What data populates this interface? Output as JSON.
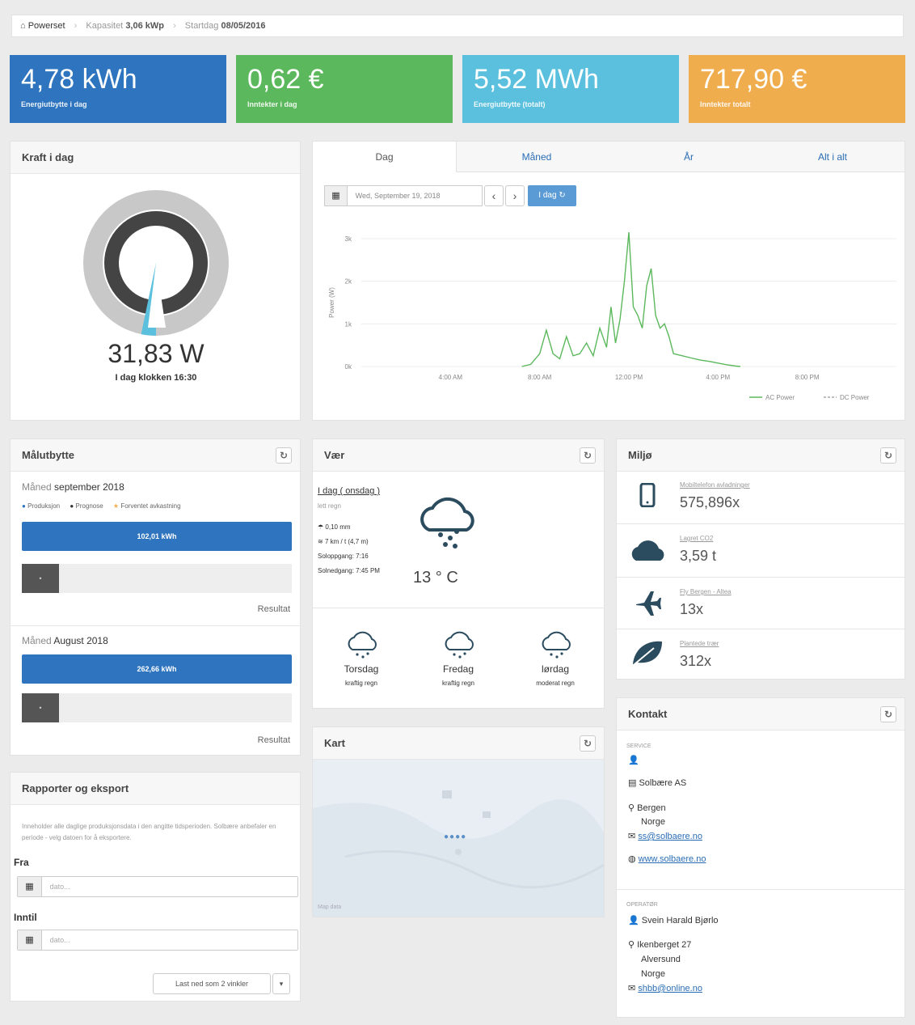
{
  "breadcrumb": {
    "home": "Powerset",
    "capacity_label": "Kapasitet",
    "capacity_value": "3,06 kWp",
    "start_label": "Startdag",
    "start_value": "08/05/2016"
  },
  "tiles": [
    {
      "value": "4,78 kWh",
      "label": "Energiutbytte i dag",
      "color": "#2e74be"
    },
    {
      "value": "0,62 €",
      "label": "Inntekter i dag",
      "color": "#5cb85c"
    },
    {
      "value": "5,52 MWh",
      "label": "Energiutbytte (totalt)",
      "color": "#5bc0de"
    },
    {
      "value": "717,90 €",
      "label": "Inntekter totalt",
      "color": "#f0ad4e"
    }
  ],
  "power_today": {
    "title": "Kraft i dag",
    "value": "31,83 W",
    "subtitle": "I dag klokken 16:30",
    "gauge_fraction": 0.02
  },
  "chart_panel": {
    "tabs": [
      "Dag",
      "Måned",
      "År",
      "Alt i alt"
    ],
    "active_tab": 0,
    "date_value": "Wed, September 19, 2018",
    "today_button": "I dag",
    "prev": "‹",
    "next": "›"
  },
  "chart_data": {
    "type": "line",
    "ylabel": "Power (W)",
    "y_ticks": [
      "0k",
      "1k",
      "2k",
      "3k"
    ],
    "x_ticks": [
      "4:00 AM",
      "8:00 AM",
      "12:00 PM",
      "4:00 PM",
      "8:00 PM"
    ],
    "ylim": [
      0,
      3000
    ],
    "xlim": [
      0,
      24
    ],
    "legend_position": "bottom-right",
    "series": [
      {
        "name": "AC Power",
        "color": "#5cb85c",
        "x": [
          7.2,
          7.6,
          8.0,
          8.3,
          8.6,
          8.9,
          9.2,
          9.5,
          9.8,
          10.1,
          10.4,
          10.7,
          11.0,
          11.2,
          11.4,
          11.6,
          11.8,
          12.0,
          12.2,
          12.4,
          12.6,
          12.8,
          13.0,
          13.2,
          13.4,
          13.6,
          13.8,
          14.0,
          14.4,
          14.8,
          15.2,
          15.6,
          16.0,
          16.4,
          16.8,
          17.0
        ],
        "y": [
          0,
          50,
          300,
          850,
          300,
          180,
          700,
          250,
          300,
          550,
          250,
          900,
          450,
          1400,
          550,
          1100,
          2000,
          3300,
          1400,
          1200,
          900,
          1900,
          2300,
          1200,
          900,
          1000,
          700,
          300,
          250,
          200,
          150,
          120,
          80,
          40,
          10,
          0
        ]
      },
      {
        "name": "DC Power",
        "color": "#aaaaaa",
        "x": [],
        "y": []
      }
    ]
  },
  "maalutbytte": {
    "title": "Målutbytte",
    "month1_label": "Måned",
    "month1_value": "september 2018",
    "legend": [
      "Produksjon",
      "Prognose",
      "Forventet avkastning"
    ],
    "legend_colors": [
      "#2e74be",
      "#333333",
      "#f0ad4e"
    ],
    "bar1_label": "102,01 kWh",
    "result1": "Resultat",
    "month2_label": "Måned",
    "month2_value": "August 2018",
    "bar2_label": "262,66 kWh",
    "result2": "Resultat"
  },
  "weather": {
    "title": "Vær",
    "day_header": "I dag ( onsdag )",
    "condition": "lett regn",
    "precip": "0,10 mm",
    "wind": "7 km / t (4,7 m)",
    "sunrise": "Soloppgang: 7:16",
    "sunset": "Solnedgang: 7:45 PM",
    "temp": "13 ° C",
    "forecast": [
      {
        "day": "Torsdag",
        "condition": "kraftig regn"
      },
      {
        "day": "Fredag",
        "condition": "kraftig regn"
      },
      {
        "day": "lørdag",
        "condition": "moderat regn"
      }
    ]
  },
  "map": {
    "title": "Kart",
    "attribution": "Map data"
  },
  "environment": {
    "title": "Miljø",
    "items": [
      {
        "label": "Mobiltelefon avladninger",
        "value": "575,896x",
        "icon": "phone-icon"
      },
      {
        "label": "Lagret CO2",
        "value": "3,59 t",
        "icon": "cloud-icon"
      },
      {
        "label": "Fly Bergen - Altea",
        "value": "13x",
        "icon": "plane-icon"
      },
      {
        "label": "Plantede trær",
        "value": "312x",
        "icon": "leaf-icon"
      }
    ]
  },
  "contact": {
    "title": "Kontakt",
    "service_label": "SERVICE",
    "company": "Solbære AS",
    "city": "Bergen",
    "country": "Norge",
    "email": "ss@solbaere.no",
    "website": "www.solbaere.no",
    "operator_label": "OPERATØR",
    "operator_name": "Svein Harald Bjørlo",
    "operator_street": "Ikenberget 27",
    "operator_city": "Alversund",
    "operator_country": "Norge",
    "operator_email": "shbb@online.no"
  },
  "reports": {
    "title": "Rapporter og eksport",
    "description": "Inneholder alle daglige produksjonsdata i den angitte tidsperioden. Solbære anbefaler en periode - velg datoen for å eksportere.",
    "from_label": "Fra",
    "to_label": "Inntil",
    "from_placeholder": "dato...",
    "to_placeholder": "dato...",
    "download_button": "Last ned som 2 vinkler"
  }
}
